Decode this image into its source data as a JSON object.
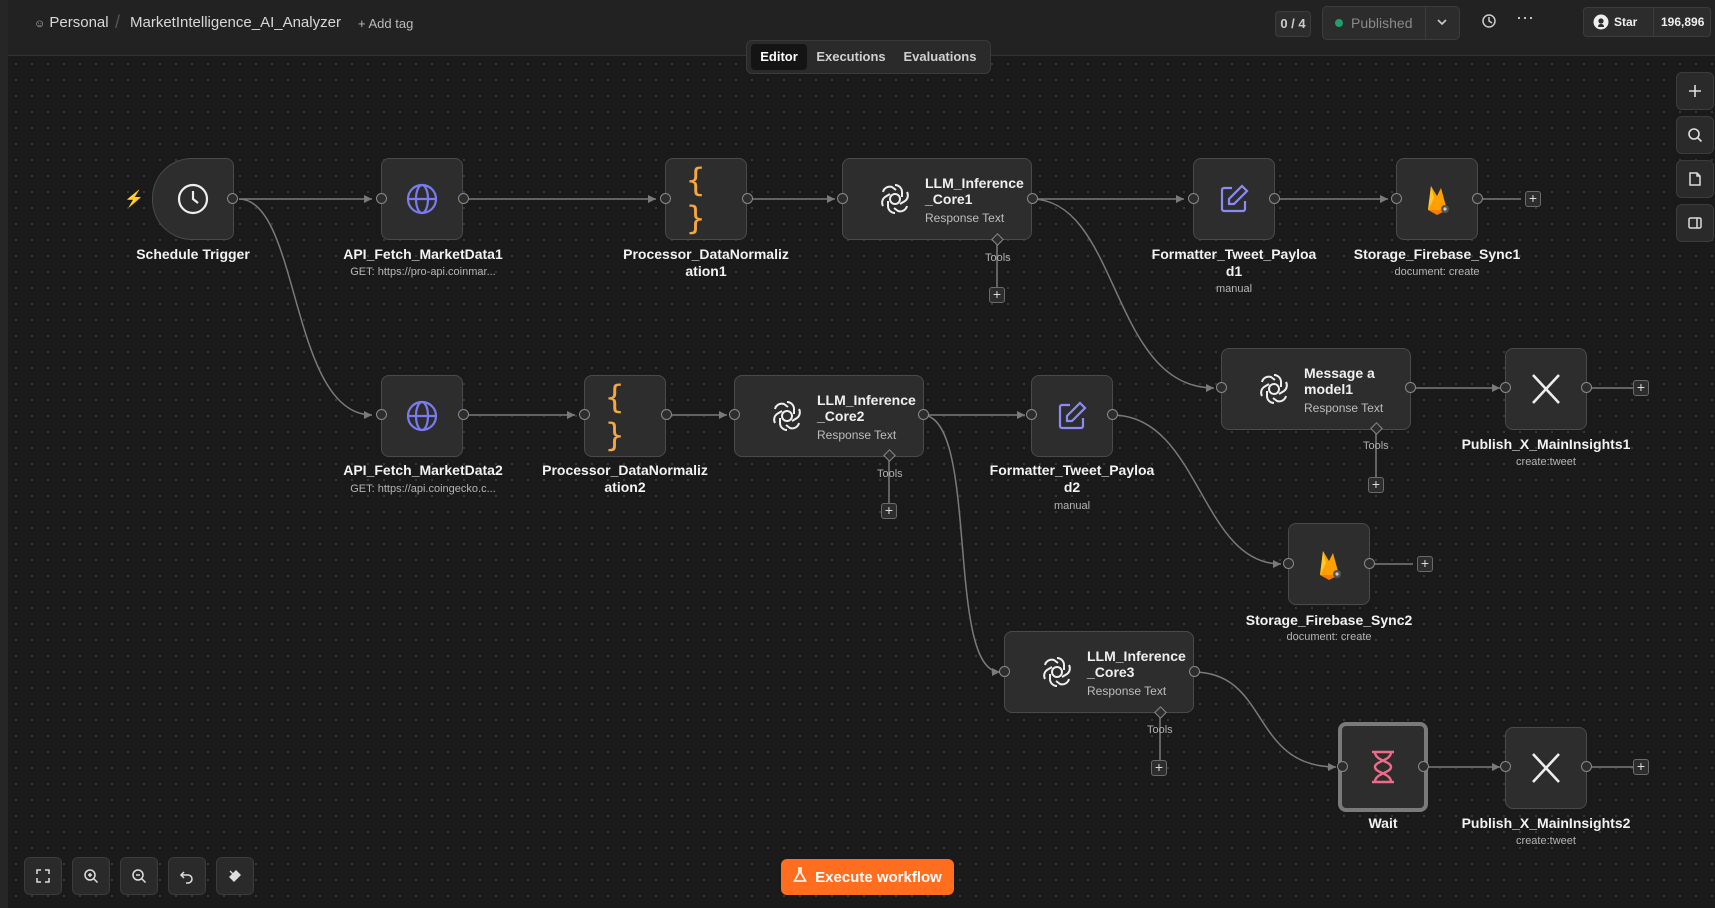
{
  "header": {
    "workspace": "Personal",
    "workflow_name": "MarketIntelligence_AI_Analyzer",
    "add_tag": "+ Add tag",
    "run_counter": "0 / 4",
    "publish_status": "Published",
    "github_star_label": "Star",
    "github_star_count": "196,896"
  },
  "tabs": [
    {
      "label": "Editor",
      "active": true
    },
    {
      "label": "Executions",
      "active": false
    },
    {
      "label": "Evaluations",
      "active": false
    }
  ],
  "nodes": {
    "schedule": {
      "title": "Schedule Trigger"
    },
    "fetch1": {
      "title": "API_Fetch_MarketData1",
      "subtitle": "GET: https://pro-api.coinmar..."
    },
    "proc1": {
      "title_line1": "Processor_DataNormaliz",
      "title_line2": "ation1"
    },
    "llm1": {
      "title": "LLM_Inference_Core1",
      "subtitle": "Response Text",
      "tools": "Tools"
    },
    "fmt1": {
      "title_line1": "Formatter_Tweet_Payloa",
      "title_line2": "d1",
      "subtitle": "manual"
    },
    "store1": {
      "title": "Storage_Firebase_Sync1",
      "subtitle": "document: create"
    },
    "msg1": {
      "title": "Message a model1",
      "subtitle": "Response Text",
      "tools": "Tools"
    },
    "pub1": {
      "title": "Publish_X_MainInsights1",
      "subtitle": "create:tweet"
    },
    "fetch2": {
      "title": "API_Fetch_MarketData2",
      "subtitle": "GET: https://api.coingecko.c..."
    },
    "proc2": {
      "title_line1": "Processor_DataNormaliz",
      "title_line2": "ation2"
    },
    "llm2": {
      "title": "LLM_Inference_Core2",
      "subtitle": "Response Text",
      "tools": "Tools"
    },
    "fmt2": {
      "title_line1": "Formatter_Tweet_Payloa",
      "title_line2": "d2",
      "subtitle": "manual"
    },
    "store2": {
      "title": "Storage_Firebase_Sync2",
      "subtitle": "document: create"
    },
    "llm3": {
      "title": "LLM_Inference_Core3",
      "subtitle": "Response Text",
      "tools": "Tools"
    },
    "wait": {
      "title": "Wait"
    },
    "pub2": {
      "title": "Publish_X_MainInsights2",
      "subtitle": "create:tweet"
    }
  },
  "actions": {
    "execute": "Execute workflow"
  },
  "icons": {
    "trigger": "clock-icon",
    "http": "globe-icon",
    "code": "braces-icon",
    "llm": "openai-icon",
    "formatter": "edit-icon",
    "firebase": "firebase-icon",
    "x": "x-logo-icon",
    "wait": "hourglass-icon"
  },
  "colors": {
    "accent": "#ff6d1f",
    "globe": "#7b7bf0",
    "braces": "#f5a742",
    "edit": "#8b8bf5",
    "wait": "#f06b8a"
  }
}
